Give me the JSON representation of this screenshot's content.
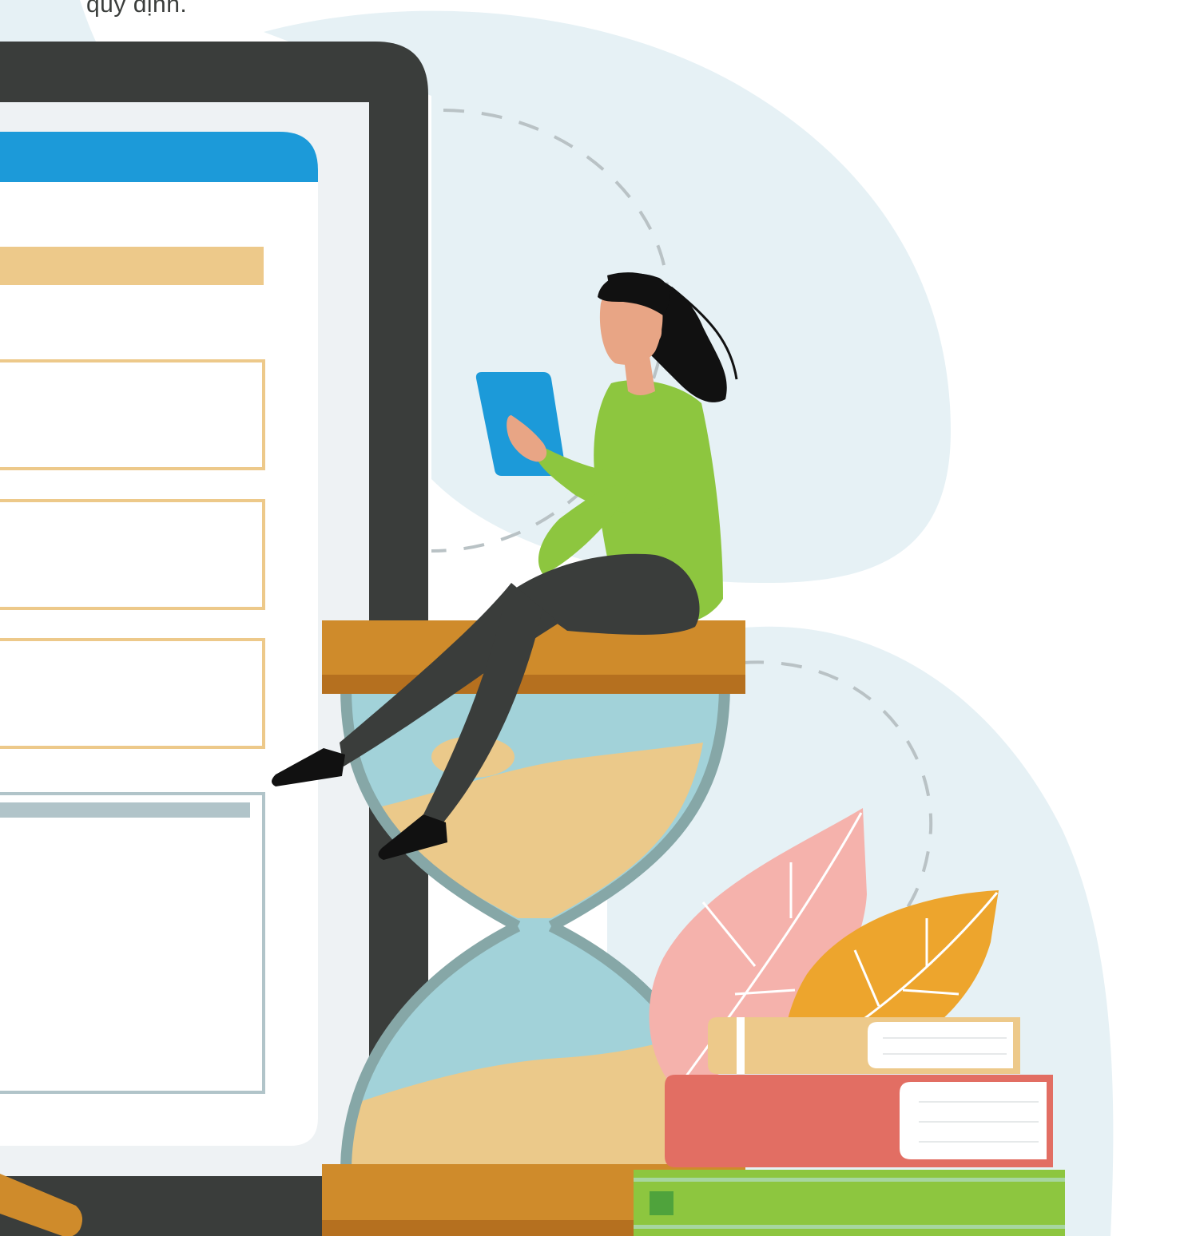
{
  "caption": {
    "text": "quy định."
  },
  "colors": {
    "background_blob": "#e6f1f5",
    "monitor_frame": "#3a3d3b",
    "screen_panel": "#eef2f4",
    "screen_card": "#ffffff",
    "header_bar": "#1c9ad9",
    "placeholder_bar": "#edc98a",
    "form_field_border": "#edc98a",
    "text_area_border": "#b1c4c9",
    "text_area_bar": "#b1c4c9",
    "caption_text": "#3a3d3b",
    "hourglass_wood": "#cf8b2b",
    "hourglass_wood_shadow": "#b5701f",
    "hourglass_glass": "#a2d2d9",
    "hourglass_glass_rim": "#86a7a7",
    "sand": "#ebc98a",
    "shirt": "#8dc63f",
    "pants": "#3a3d3b",
    "skin": "#e8a585",
    "hair": "#111111",
    "tablet": "#1c9ad9",
    "leaf_pink": "#f5b2ac",
    "leaf_orange": "#eda52d",
    "book_top": "#edc98a",
    "book_middle": "#e26e63",
    "book_bottom": "#8dc63f"
  },
  "screen": {
    "form_fields": 3,
    "has_text_area": true
  },
  "icons": [
    "monitor-illustration",
    "woman-reading-tablet-illustration",
    "hourglass-illustration",
    "leaves-illustration",
    "book-stack-illustration"
  ]
}
